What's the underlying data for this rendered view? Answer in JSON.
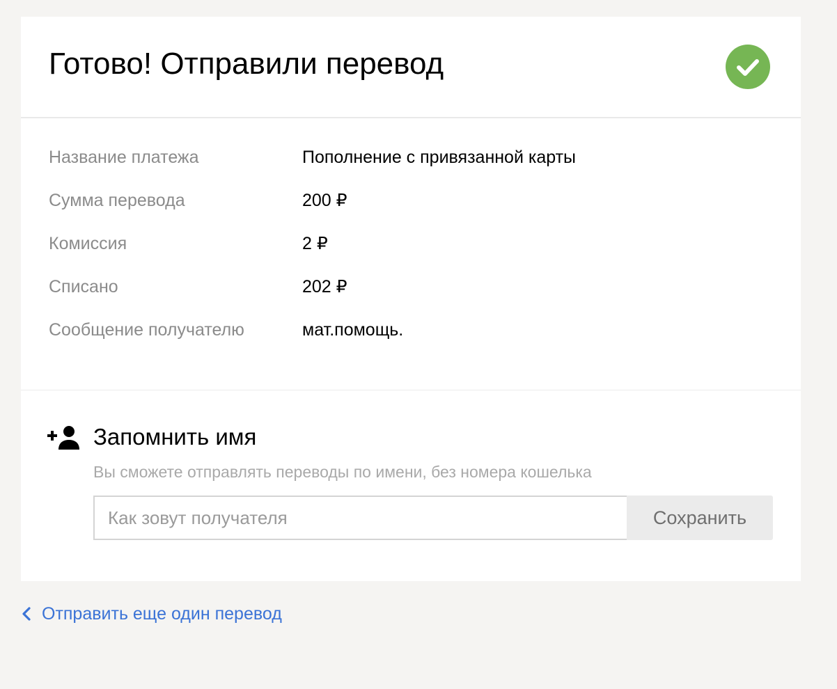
{
  "header": {
    "title": "Готово! Отправили перевод",
    "status_icon": "check-circle-icon",
    "status_color": "#76b654"
  },
  "details": [
    {
      "label": "Название платежа",
      "value": "Пополнение с привязанной карты"
    },
    {
      "label": "Сумма перевода",
      "value": "200 ₽"
    },
    {
      "label": "Комиссия",
      "value": "2 ₽"
    },
    {
      "label": "Списано",
      "value": "202 ₽"
    },
    {
      "label": "Сообщение получателю",
      "value": "мат.помощь."
    }
  ],
  "remember": {
    "icon": "add-user-icon",
    "title": "Запомнить имя",
    "hint": "Вы сможете отправлять переводы по имени, без номера кошелька",
    "input_value": "",
    "input_placeholder": "Как зовут получателя",
    "save_label": "Сохранить"
  },
  "footer": {
    "back_icon": "chevron-left-icon",
    "back_link": "Отправить еще один перевод",
    "link_color": "#3b73d6"
  }
}
